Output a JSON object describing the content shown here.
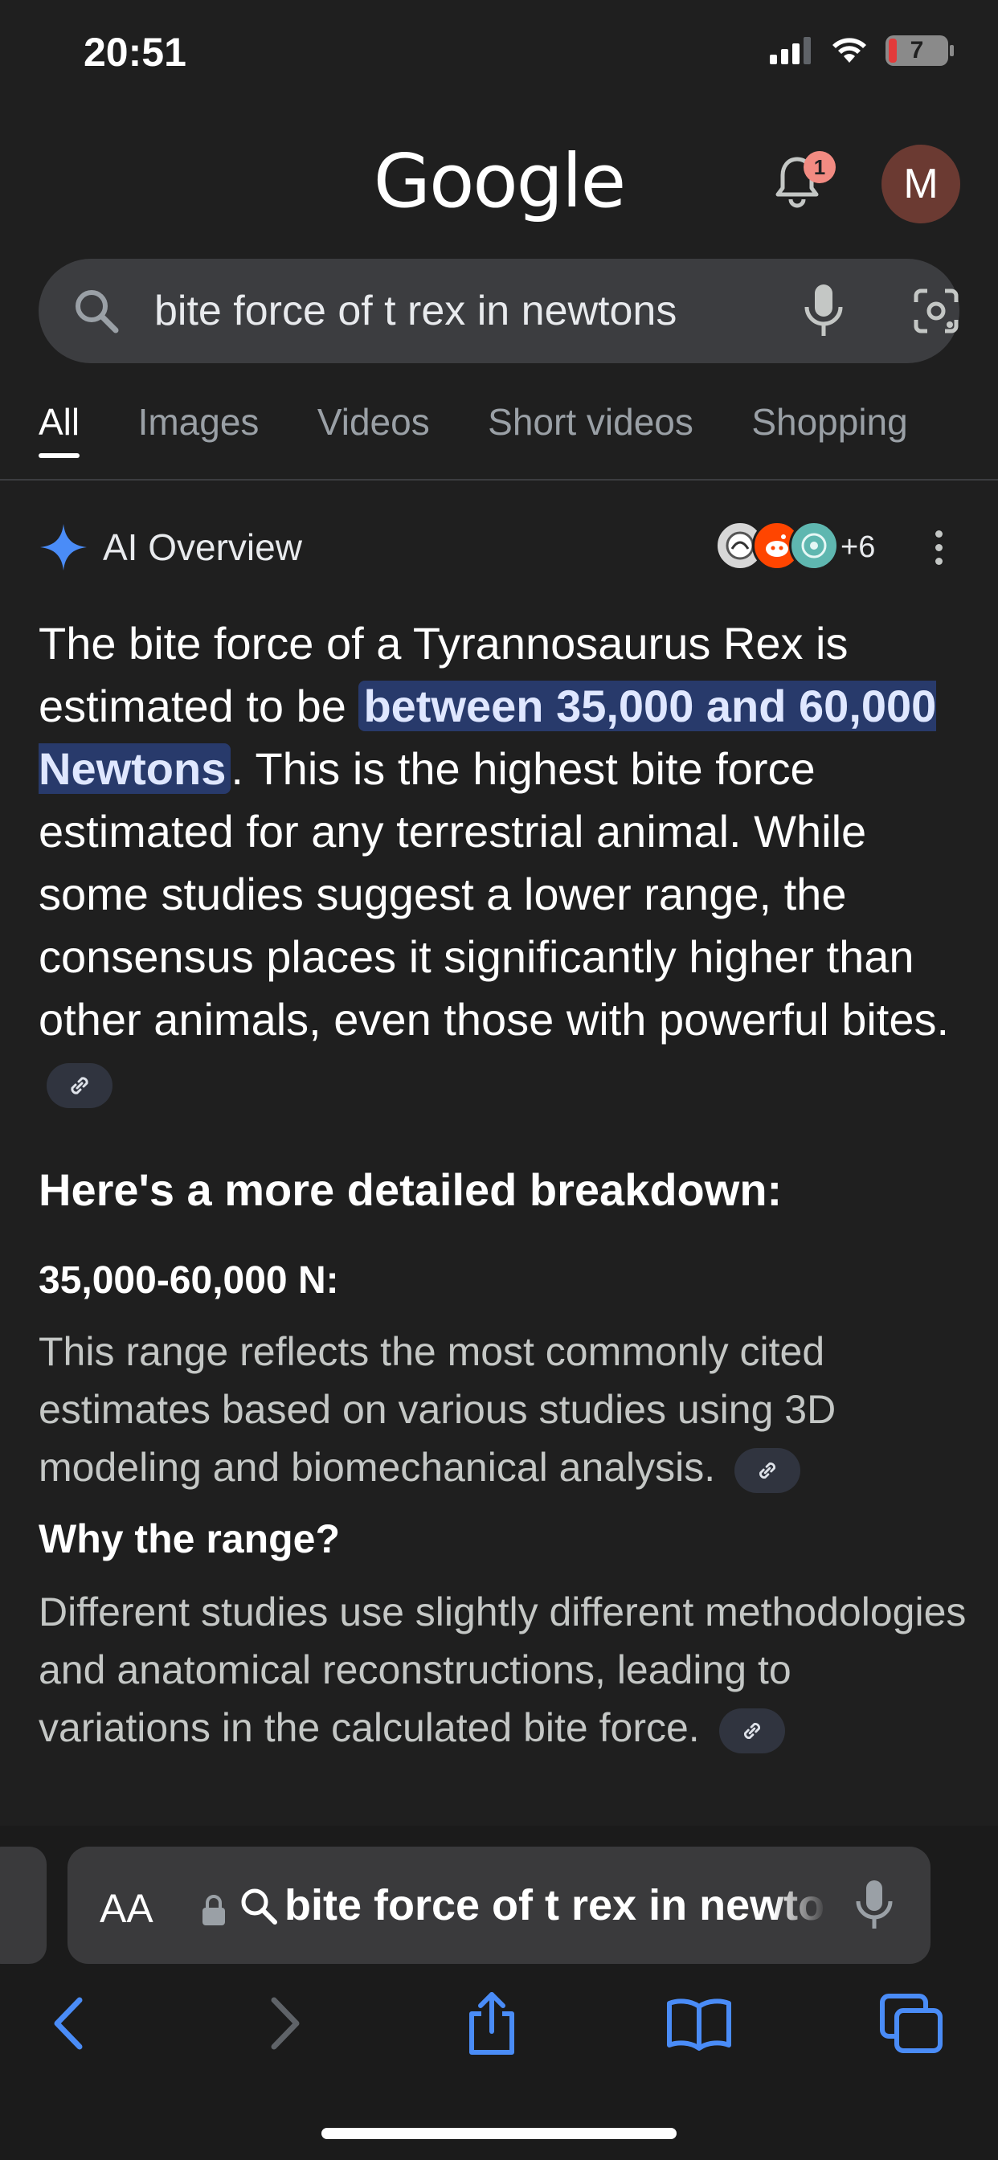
{
  "status": {
    "time": "20:51",
    "battery": "7"
  },
  "header": {
    "logo": "Google",
    "notifications": "1",
    "avatar_initial": "M"
  },
  "search": {
    "query": "bite force of t rex in newtons"
  },
  "tabs": [
    {
      "label": "All",
      "active": true
    },
    {
      "label": "Images"
    },
    {
      "label": "Videos"
    },
    {
      "label": "Short videos"
    },
    {
      "label": "Shopping"
    }
  ],
  "ai_overview": {
    "title": "AI Overview",
    "sources_more": "+6",
    "source_icons": [
      "dinosaur-site-icon",
      "reddit-icon",
      "science-site-icon"
    ],
    "para_before": "The bite force of a Tyrannosaurus Rex is estimated to be ",
    "para_highlight": "between 35,000 and 60,000 Newtons",
    "para_after": ". This is the highest bite force estimated for any terrestrial animal. While some studies suggest a lower range, the consensus places it significantly higher than other animals, even those with powerful bites.",
    "breakdown_heading": "Here's a more detailed breakdown:",
    "items": [
      {
        "heading": "35,000-60,000 N:",
        "text": "This range reflects the most commonly cited estimates based on various studies using 3D modeling and biomechanical analysis."
      },
      {
        "heading": "Why the range?",
        "text": "Different studies use slightly different methodologies and anatomical reconstructions, leading to variations in the calculated bite force."
      }
    ]
  },
  "browser": {
    "aa_label": "AA",
    "address_text": "bite force of t rex in newtons"
  },
  "colors": {
    "background": "#1f1f1f",
    "highlight": "#283a6b",
    "accent": "#4a8cf7"
  }
}
